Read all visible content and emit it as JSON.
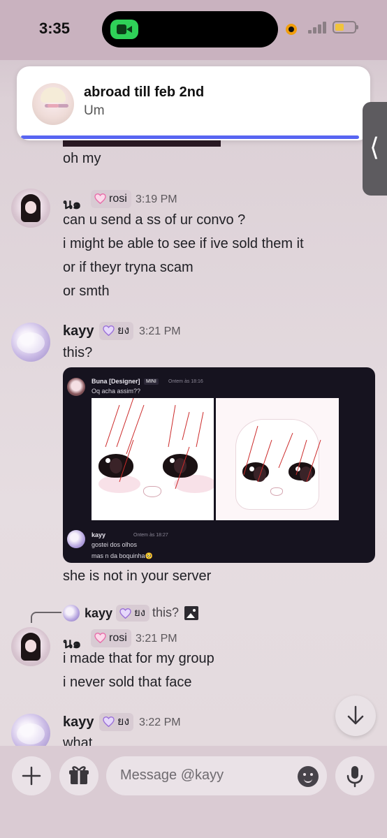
{
  "status_bar": {
    "time": "3:35"
  },
  "notification": {
    "title": "abroad till feb 2nd",
    "body": "Um"
  },
  "messages": [
    {
      "text": "oh my"
    },
    {
      "author": "น๑",
      "tag": "rosi",
      "time": "3:19 PM",
      "lines": [
        "can u send a ss of ur convo ?",
        "i might be able to see if ive sold them it",
        "or if theyr tryna scam",
        "or smth"
      ]
    },
    {
      "author": "kayy",
      "tag": "ยง",
      "time": "3:21 PM",
      "lines": [
        "this?"
      ]
    },
    {
      "text": "she is not in your server"
    },
    {
      "reply_author": "kayy",
      "reply_tag": "ยง",
      "reply_text": "this?",
      "author": "น๑",
      "tag": "rosi",
      "time": "3:21 PM",
      "lines": [
        "i made that for my group",
        "i never sold that face"
      ]
    },
    {
      "author": "kayy",
      "tag": "ยง",
      "time": "3:22 PM",
      "lines": [
        "what"
      ]
    }
  ],
  "embed": {
    "author": "Buna [Designer]",
    "badge": "MINI",
    "time": "Ontem às 18:16",
    "text": "Oq acha assim??",
    "reply_author": "kayy",
    "reply_tag": "ยง",
    "reply_time": "Ontem às 18:27",
    "reply_line1": "gostei dos olhos",
    "reply_line2": "mas n da boquinha🥺"
  },
  "composer": {
    "placeholder": "Message @kayy"
  },
  "colors": {
    "accent": "#5865f2",
    "tag_bg": "#d8cbd3",
    "heart_pink": "#e86ba8",
    "heart_purple": "#9a6fd8"
  }
}
